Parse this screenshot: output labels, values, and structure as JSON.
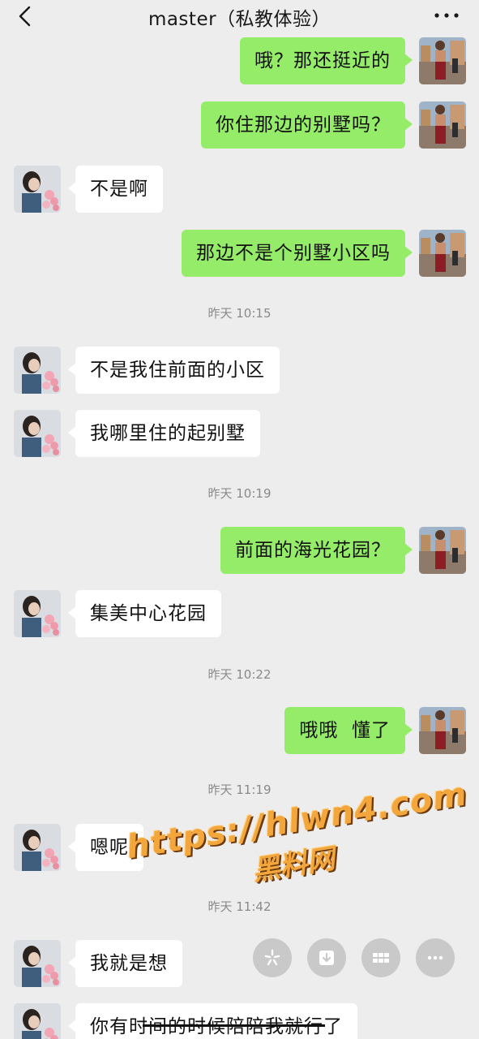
{
  "header": {
    "title": "master（私教体验）",
    "back_icon": "chevron-left-icon",
    "more_icon": "ellipsis-icon"
  },
  "colors": {
    "background": "#ededed",
    "sent_bubble": "#95ec69",
    "received_bubble": "#ffffff",
    "watermark": "#f3a63c"
  },
  "messages": [
    {
      "side": "right",
      "text": "哦？那还挺近的"
    },
    {
      "side": "right",
      "text": "你住那边的别墅吗？"
    },
    {
      "side": "left",
      "text": "不是啊"
    },
    {
      "side": "right",
      "text": "那边不是个别墅小区吗"
    },
    {
      "timestamp": "昨天 10:15"
    },
    {
      "side": "left",
      "text": "不是我住前面的小区"
    },
    {
      "side": "left",
      "text": "我哪里住的起别墅"
    },
    {
      "timestamp": "昨天 10:19"
    },
    {
      "side": "right",
      "text": "前面的海光花园？"
    },
    {
      "side": "left",
      "text": "集美中心花园"
    },
    {
      "timestamp": "昨天 10:22"
    },
    {
      "side": "right",
      "text": "哦哦  懂了"
    },
    {
      "timestamp": "昨天 11:19"
    },
    {
      "side": "left",
      "text": "嗯呢"
    },
    {
      "timestamp": "昨天 11:42"
    },
    {
      "side": "left",
      "text": "我就是想"
    },
    {
      "side": "left",
      "text": "你有时间的时候陪陪我就行了"
    }
  ],
  "watermark": {
    "line1": "https://hlwn4.com",
    "line2": "黑料网"
  },
  "floating_buttons": [
    {
      "icon": "sparkle-icon"
    },
    {
      "icon": "download-icon"
    },
    {
      "icon": "grid-icon"
    },
    {
      "icon": "more-dots-icon"
    }
  ]
}
